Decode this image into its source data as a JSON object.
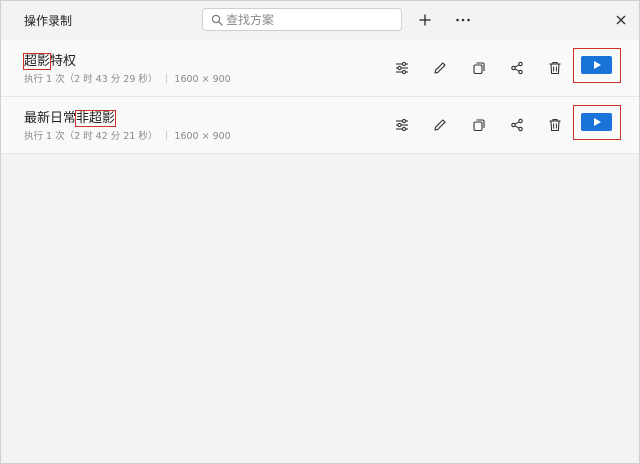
{
  "app": {
    "title": "操作录制"
  },
  "search": {
    "placeholder": "查找方案",
    "value": ""
  },
  "toolbar": {
    "add_icon": "plus-icon",
    "more_icon": "more-horizontal-icon",
    "close_icon": "close-icon"
  },
  "recordings": [
    {
      "name_highlight": "超影",
      "name_rest": "特权",
      "runs": "执行 1 次（2 时 43 分 29 秒）",
      "resolution": "1600 × 900"
    },
    {
      "name_prefix": "最新日常",
      "name_highlight": "非超影",
      "runs": "执行 1 次（2 时 42 分 21 秒）",
      "resolution": "1600 × 900"
    }
  ],
  "row_actions": [
    "settings-sliders-icon",
    "edit-pencil-icon",
    "copy-icon",
    "share-icon",
    "delete-trash-icon",
    "play-icon"
  ],
  "colors": {
    "accent": "#1a73d9",
    "highlight_box": "#d0302a",
    "background": "#f3f3f3"
  }
}
